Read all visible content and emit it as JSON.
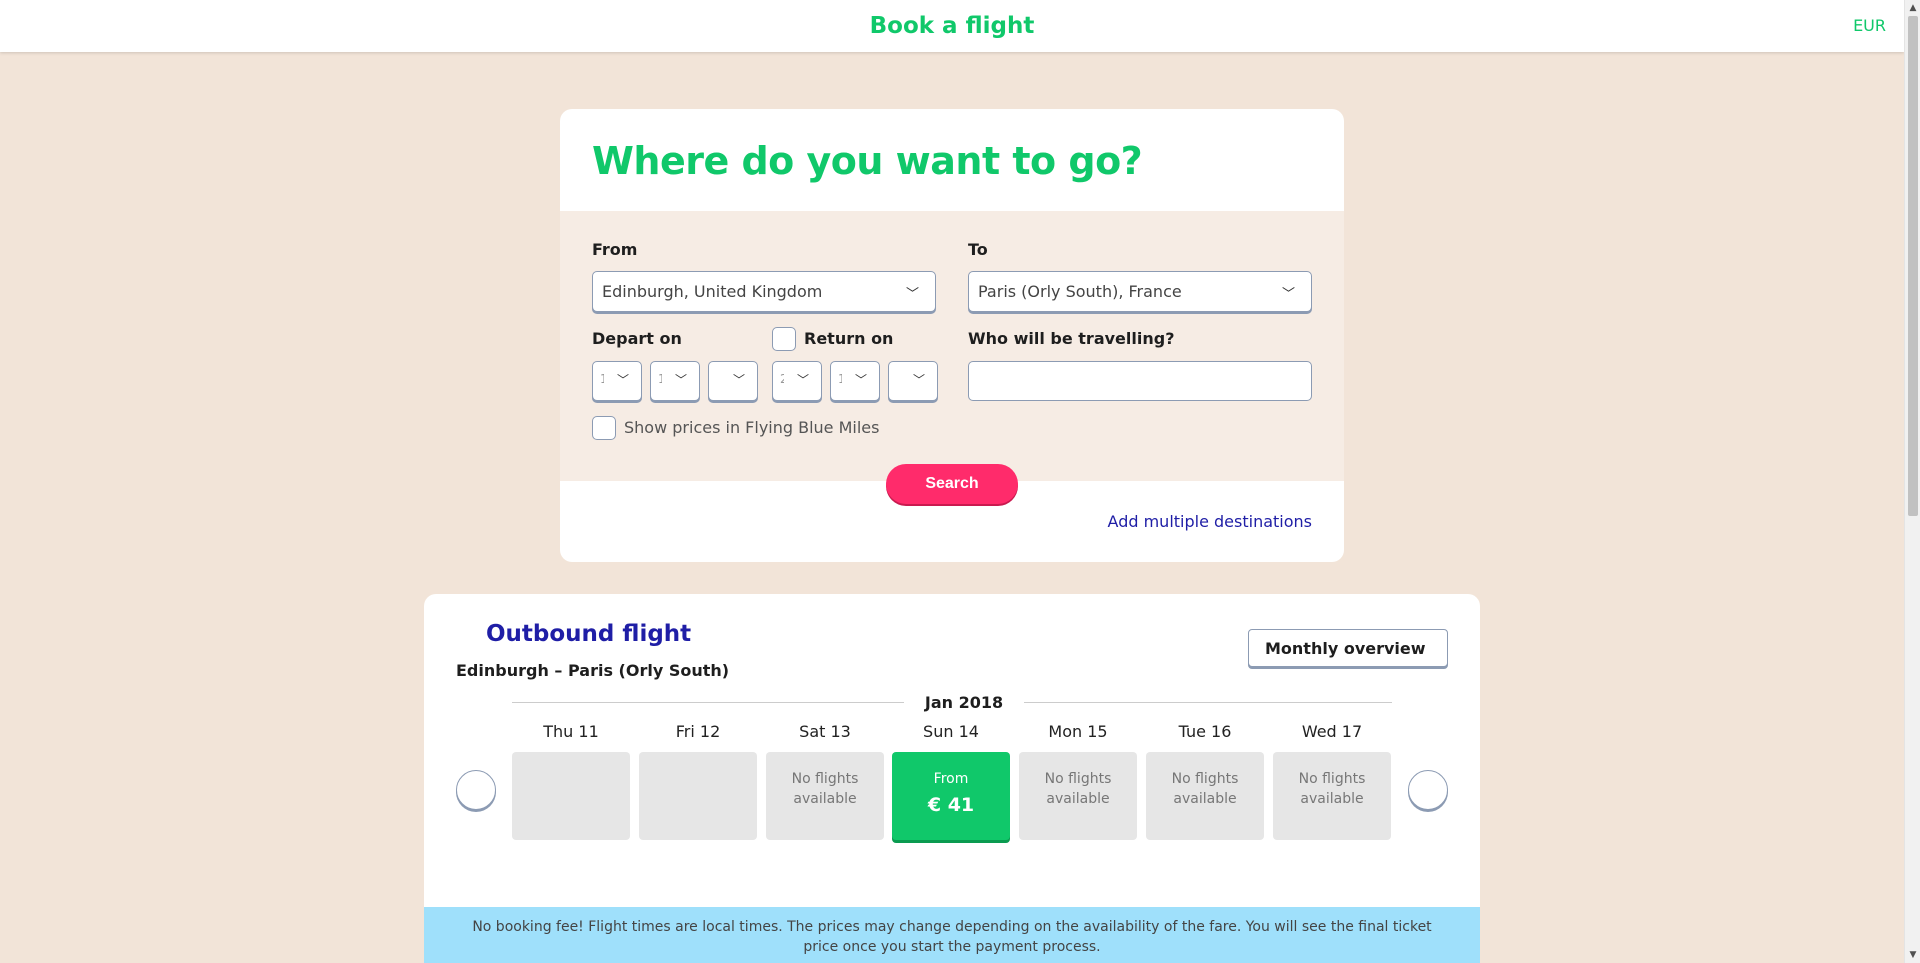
{
  "header": {
    "title": "Book a flight",
    "currency": "EUR"
  },
  "search": {
    "heading": "Where do you want to go?",
    "from_label": "From",
    "from_value": "Edinburgh, United Kingdom",
    "to_label": "To",
    "to_value": "Paris (Orly South), France",
    "depart_label": "Depart on",
    "return_label": "Return on",
    "travellers_label": "Who will be travelling?",
    "miles_label": "Show prices in Flying Blue Miles",
    "search_button": "Search",
    "multi_link": "Add multiple destinations"
  },
  "outbound": {
    "title": "Outbound flight",
    "route": "Edinburgh – Paris (Orly South)",
    "monthly_button": "Monthly overview",
    "month": "Jan 2018",
    "days": [
      {
        "label": "Thu 11",
        "status": ""
      },
      {
        "label": "Fri 12",
        "status": ""
      },
      {
        "label": "Sat 13",
        "status": "No flights available"
      },
      {
        "label": "Sun 14",
        "from": "From",
        "price": "€ 41"
      },
      {
        "label": "Mon 15",
        "status": "No flights available"
      },
      {
        "label": "Tue 16",
        "status": "No flights available"
      },
      {
        "label": "Wed 17",
        "status": "No flights available"
      }
    ],
    "notice": "No booking fee! Flight times are local times. The prices may change depending on the availability of the fare. You will see the final ticket price once you start the payment process."
  },
  "colors": {
    "brand_green": "#10c86a",
    "accent_pink": "#ff2b6b",
    "link_blue": "#1f1ea6",
    "background": "#f2e4d8"
  }
}
